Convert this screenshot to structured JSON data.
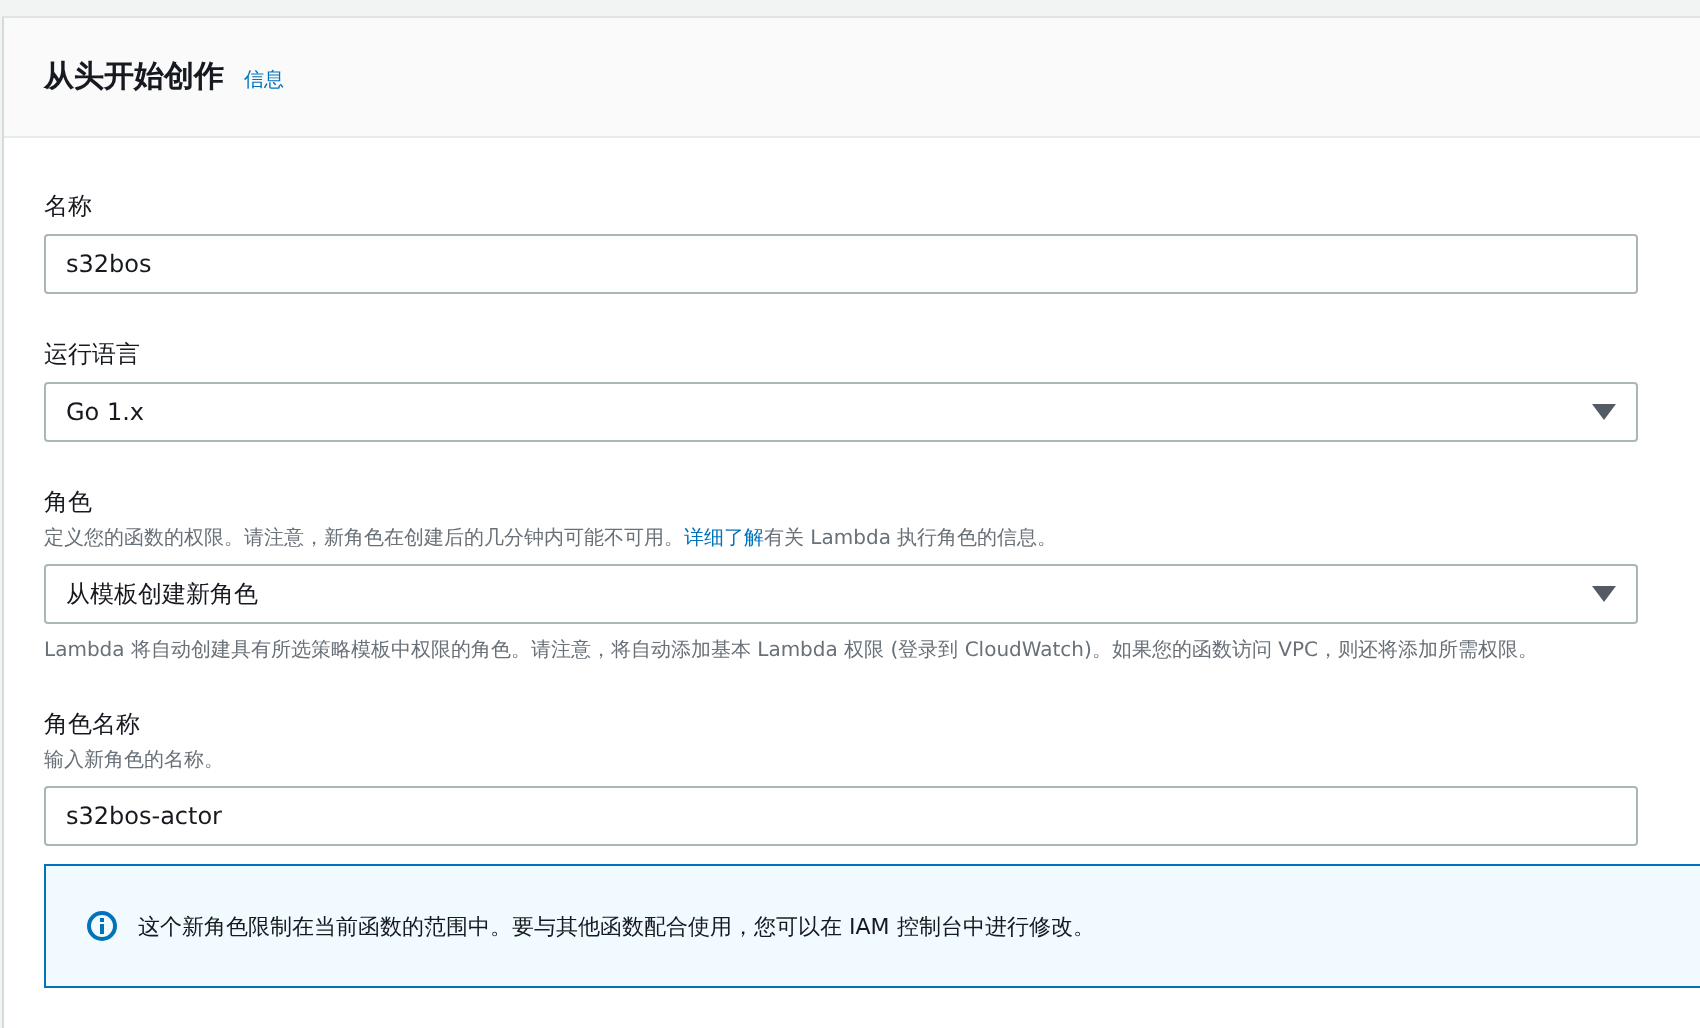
{
  "header": {
    "title": "从头开始创作",
    "info_link": "信息"
  },
  "fields": [
    {
      "kind": "text",
      "label": "名称",
      "value": "s32bos"
    },
    {
      "kind": "select",
      "label": "运行语言",
      "value": "Go 1.x"
    },
    {
      "kind": "select",
      "label": "角色",
      "description": [
        {
          "kind": "text",
          "text": "定义您的函数的权限。请注意，新角色在创建后的几分钟内可能不可用。"
        },
        {
          "kind": "link",
          "text": "详细了解"
        },
        {
          "kind": "text",
          "text": "有关 Lambda 执行角色的信息。"
        }
      ],
      "value": "从模板创建新角色",
      "help": "Lambda 将自动创建具有所选策略模板中权限的角色。请注意，将自动添加基本 Lambda 权限 (登录到 CloudWatch)。如果您的函数访问 VPC，则还将添加所需权限。"
    },
    {
      "kind": "text",
      "label": "角色名称",
      "description": [
        {
          "kind": "text",
          "text": "输入新角色的名称。"
        }
      ],
      "value": "s32bos-actor"
    }
  ],
  "alert": {
    "kind": "info",
    "message": "这个新角色限制在当前函数的范围中。要与其他函数配合使用，您可以在 IAM 控制台中进行修改。"
  }
}
